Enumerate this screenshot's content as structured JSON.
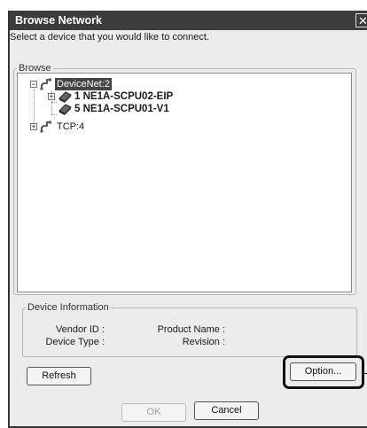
{
  "window": {
    "title": "Browse Network",
    "close_symbol": "✕"
  },
  "prompt": "Select a device that you would like to connect.",
  "browse": {
    "legend": "Browse",
    "tree": [
      {
        "label": "DeviceNet:2",
        "icon": "network-icon",
        "selected": true,
        "expander": "−"
      },
      {
        "label": "1 NE1A-SCPU02-EIP",
        "icon": "device-icon",
        "bold": true,
        "expander": "+"
      },
      {
        "label": "5 NE1A-SCPU01-V1",
        "icon": "device-icon",
        "bold": true
      },
      {
        "label": "TCP:4",
        "icon": "network-icon",
        "expander": "+"
      }
    ]
  },
  "device_info": {
    "legend": "Device Information",
    "vendor_id_label": "Vendor ID :",
    "device_type_label": "Device Type :",
    "product_name_label": "Product Name :",
    "revision_label": "Revision :"
  },
  "buttons": {
    "refresh": "Refresh",
    "option": "Option...",
    "ok": "OK",
    "cancel": "Cancel"
  }
}
